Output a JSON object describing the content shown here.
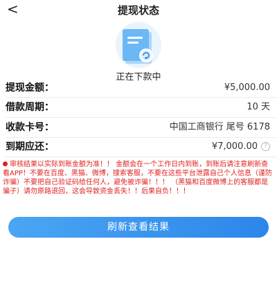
{
  "header": {
    "back_glyph": "<",
    "title": "提现状态"
  },
  "status": {
    "icon": "document-refresh-icon",
    "text": "正在下款中"
  },
  "details": [
    {
      "label": "提现金额：",
      "value": "¥5,000.00"
    },
    {
      "label": "借款周期：",
      "value": "10 天"
    },
    {
      "label": "收款卡号：",
      "value": "中国工商银行 尾号 6178"
    },
    {
      "label": "到期应还：",
      "value": "¥7,000.00",
      "help_glyph": "?"
    }
  ],
  "notice": "审核结果以实际到账金额为准！！ 金额会在一个工作日内到账，到账后请注意刷新查看APP！不要在百度、黑猫、微博，搜索客服，不要在这些平台泄露自己个人信息（谨防诈骗）不要把自己验证码给任何人，避免被诈骗！！！ （黑猫和百度微博上的客服都是骗子）请勿原路退回，这会导致资金丢失！！后果自负！！！",
  "button": {
    "label": "刷新查看结果"
  },
  "colors": {
    "accent": "#2c86ea",
    "warning": "#e02020"
  }
}
